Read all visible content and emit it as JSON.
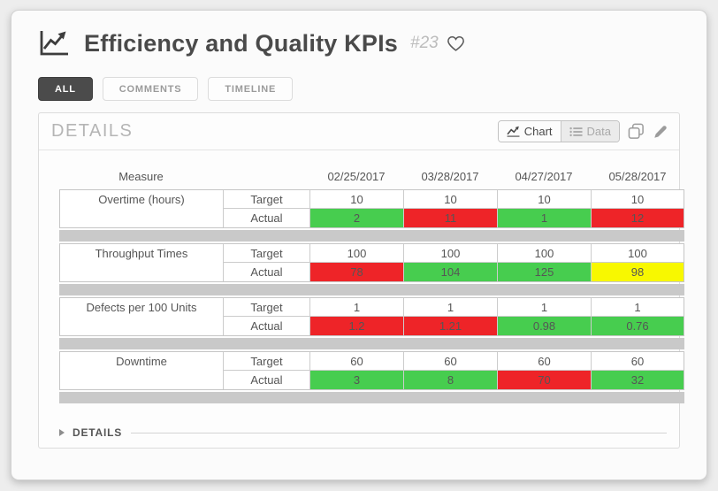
{
  "header": {
    "title": "Efficiency and Quality KPIs",
    "number": "#23",
    "icon": "line-chart-icon",
    "favorite_icon": "heart-outline-icon"
  },
  "tabs": [
    {
      "label": "ALL",
      "active": true
    },
    {
      "label": "COMMENTS",
      "active": false
    },
    {
      "label": "TIMELINE",
      "active": false
    }
  ],
  "panel": {
    "title": "DETAILS",
    "view_toggle": [
      {
        "label": "Chart",
        "icon": "line-chart-icon",
        "active": true
      },
      {
        "label": "Data",
        "icon": "list-icon",
        "active": false
      }
    ],
    "actions": [
      {
        "icon": "copy-icon"
      },
      {
        "icon": "edit-pencil-icon"
      }
    ]
  },
  "table": {
    "measure_header": "Measure",
    "dates": [
      "02/25/2017",
      "03/28/2017",
      "04/27/2017",
      "05/28/2017"
    ],
    "target_label": "Target",
    "actual_label": "Actual",
    "groups": [
      {
        "measure": "Overtime (hours)",
        "target": [
          "10",
          "10",
          "10",
          "10"
        ],
        "actual": [
          {
            "value": "2",
            "status": "green"
          },
          {
            "value": "11",
            "status": "red"
          },
          {
            "value": "1",
            "status": "green"
          },
          {
            "value": "12",
            "status": "red"
          }
        ]
      },
      {
        "measure": "Throughput Times",
        "target": [
          "100",
          "100",
          "100",
          "100"
        ],
        "actual": [
          {
            "value": "78",
            "status": "red"
          },
          {
            "value": "104",
            "status": "green"
          },
          {
            "value": "125",
            "status": "green"
          },
          {
            "value": "98",
            "status": "yellow"
          }
        ]
      },
      {
        "measure": "Defects per 100 Units",
        "target": [
          "1",
          "1",
          "1",
          "1"
        ],
        "actual": [
          {
            "value": "1.2",
            "status": "red"
          },
          {
            "value": "1.21",
            "status": "red"
          },
          {
            "value": "0.98",
            "status": "green"
          },
          {
            "value": "0.76",
            "status": "green"
          }
        ]
      },
      {
        "measure": "Downtime",
        "target": [
          "60",
          "60",
          "60",
          "60"
        ],
        "actual": [
          {
            "value": "3",
            "status": "green"
          },
          {
            "value": "8",
            "status": "green"
          },
          {
            "value": "70",
            "status": "red"
          },
          {
            "value": "32",
            "status": "green"
          }
        ]
      }
    ]
  },
  "footer": {
    "label": "DETAILS"
  },
  "colors": {
    "green": "#47cd4f",
    "red": "#ee2428",
    "yellow": "#f8f800"
  }
}
